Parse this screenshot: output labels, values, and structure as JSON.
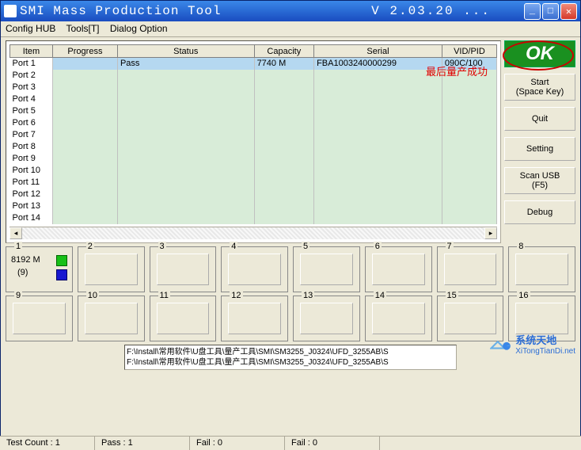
{
  "window": {
    "title": "SMI Mass Production Tool",
    "version": "V 2.03.20  ..."
  },
  "menu": {
    "config": "Config HUB",
    "tools": "Tools[T]",
    "dialog": "Dialog Option"
  },
  "grid": {
    "headers": {
      "item": "Item",
      "progress": "Progress",
      "status": "Status",
      "capacity": "Capacity",
      "serial": "Serial",
      "vidpid": "VID/PID"
    },
    "rows": [
      {
        "item": "Port 1",
        "progress": "",
        "status": "Pass",
        "capacity": "7740 M",
        "serial": "FBA1003240000299",
        "vidpid": "090C/100"
      },
      {
        "item": "Port 2"
      },
      {
        "item": "Port 3"
      },
      {
        "item": "Port 4"
      },
      {
        "item": "Port 5"
      },
      {
        "item": "Port 6"
      },
      {
        "item": "Port 7"
      },
      {
        "item": "Port 8"
      },
      {
        "item": "Port 9"
      },
      {
        "item": "Port 10"
      },
      {
        "item": "Port 11"
      },
      {
        "item": "Port 12"
      },
      {
        "item": "Port 13"
      },
      {
        "item": "Port 14"
      }
    ],
    "annotation": "最后量产成功"
  },
  "buttons": {
    "ok": "OK",
    "start": "Start",
    "start_sub": "(Space Key)",
    "quit": "Quit",
    "setting": "Setting",
    "scan": "Scan USB",
    "scan_sub": "(F5)",
    "debug": "Debug"
  },
  "slots": {
    "labels": [
      "1",
      "2",
      "3",
      "4",
      "5",
      "6",
      "7",
      "8",
      "9",
      "10",
      "11",
      "12",
      "13",
      "14",
      "15",
      "16"
    ],
    "active": {
      "capacity": "8192 M",
      "count": "(9)"
    }
  },
  "paths": {
    "line1": "F:\\Install\\常用软件\\U盘工具\\量产工具\\SMI\\SM3255_J0324\\UFD_3255AB\\S",
    "line2": "F:\\Install\\常用软件\\U盘工具\\量产工具\\SMI\\SM3255_J0324\\UFD_3255AB\\S"
  },
  "status": {
    "test": "Test Count : 1",
    "pass": "Pass : 1",
    "fail1": "Fail : 0",
    "fail2": "Fail : 0"
  },
  "watermark": {
    "brand": "系统天地",
    "url": "XiTongTianDi.net"
  }
}
